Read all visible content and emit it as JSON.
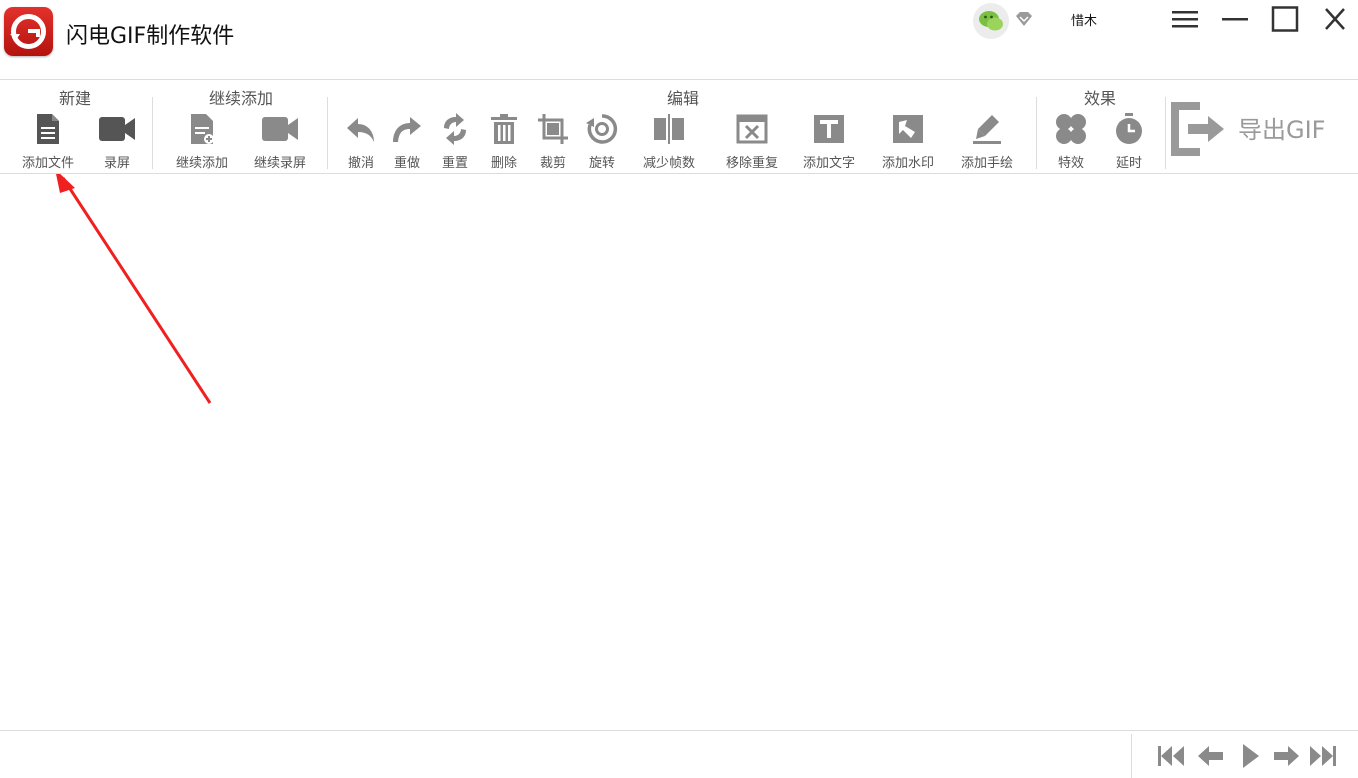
{
  "app": {
    "title": "闪电GIF制作软件",
    "username": "惜木"
  },
  "toolbar": {
    "groups": [
      {
        "title": "新建",
        "tools": [
          {
            "label": "添加文件"
          },
          {
            "label": "录屏"
          }
        ]
      },
      {
        "title": "继续添加",
        "tools": [
          {
            "label": "继续添加"
          },
          {
            "label": "继续录屏"
          }
        ]
      },
      {
        "title": "编辑",
        "tools": [
          {
            "label": "撤消"
          },
          {
            "label": "重做"
          },
          {
            "label": "重置"
          },
          {
            "label": "删除"
          },
          {
            "label": "裁剪"
          },
          {
            "label": "旋转"
          },
          {
            "label": "减少帧数"
          },
          {
            "label": "移除重复"
          },
          {
            "label": "添加文字"
          },
          {
            "label": "添加水印"
          },
          {
            "label": "添加手绘"
          }
        ]
      },
      {
        "title": "效果",
        "tools": [
          {
            "label": "特效"
          },
          {
            "label": "延时"
          }
        ]
      }
    ],
    "export_label": "导出GIF"
  },
  "colors": {
    "brand": "#d42622",
    "icon_dark": "#555555",
    "icon_gray": "#8a8a8a",
    "arrow": "#f02020"
  }
}
